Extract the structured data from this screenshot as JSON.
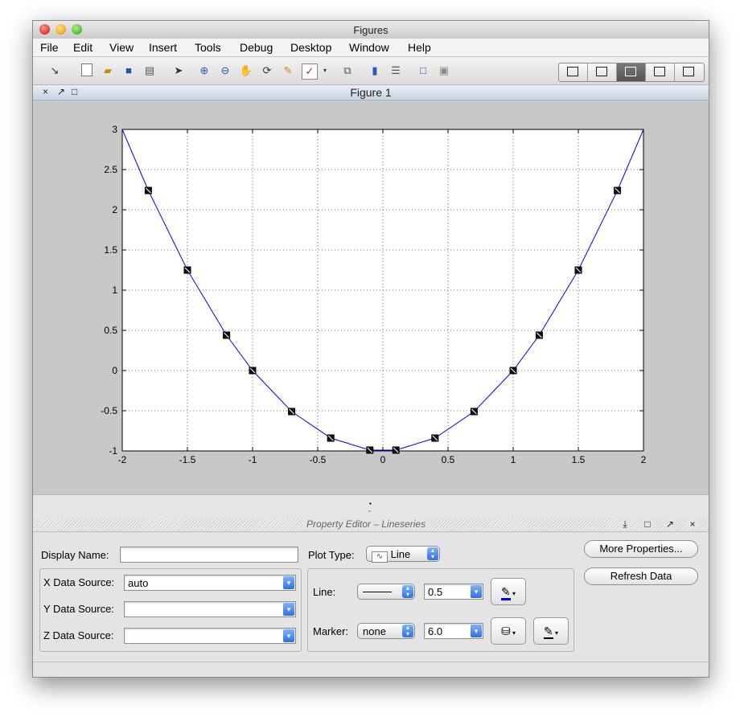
{
  "window": {
    "title": "Figures"
  },
  "menu": [
    "File",
    "Edit",
    "View",
    "Insert",
    "Tools",
    "Debug",
    "Desktop",
    "Window",
    "Help"
  ],
  "figure": {
    "tab_title": "Figure 1",
    "close_glyph": "×",
    "undock_glyph": "↗",
    "max_glyph": "□"
  },
  "chart_data": {
    "type": "line",
    "xlim": [
      -2,
      2
    ],
    "ylim": [
      -1,
      3
    ],
    "xticks": [
      "-2",
      "-1.5",
      "-1",
      "-0.5",
      "0",
      "0.5",
      "1",
      "1.5",
      "2"
    ],
    "yticks": [
      "-1",
      "-0.5",
      "0",
      "0.5",
      "1",
      "1.5",
      "2",
      "2.5",
      "3"
    ],
    "grid": true,
    "series": [
      {
        "line_color": "#0000ff",
        "x": [
          -2,
          -1.8,
          -1.5,
          -1.2,
          -1,
          -0.7,
          -0.4,
          -0.1,
          0.1,
          0.4,
          0.7,
          1,
          1.2,
          1.5,
          1.8,
          2
        ],
        "y": [
          3,
          2.24,
          1.25,
          0.44,
          0,
          -0.51,
          -0.84,
          -0.99,
          -0.99,
          -0.84,
          -0.51,
          0,
          0.44,
          1.25,
          2.24,
          3
        ]
      }
    ],
    "selected_marker_x": [
      -1.8,
      -1.5,
      -1.2,
      -1,
      -0.7,
      -0.4,
      -0.1,
      0.1,
      0.4,
      0.7,
      1,
      1.2,
      1.5,
      1.8
    ]
  },
  "property_editor": {
    "title": "Property Editor – Lineseries",
    "display_name_label": "Display Name:",
    "display_name_value": "",
    "plot_type_label": "Plot Type:",
    "plot_type_value": "Line",
    "x_source_label": "X Data Source:",
    "x_source_value": "auto",
    "y_source_label": "Y Data Source:",
    "y_source_value": "",
    "z_source_label": "Z Data Source:",
    "z_source_value": "",
    "line_label": "Line:",
    "line_width": "0.5",
    "marker_label": "Marker:",
    "marker_value": "none",
    "marker_size": "6.0",
    "more_properties": "More Properties...",
    "refresh_data": "Refresh Data"
  }
}
